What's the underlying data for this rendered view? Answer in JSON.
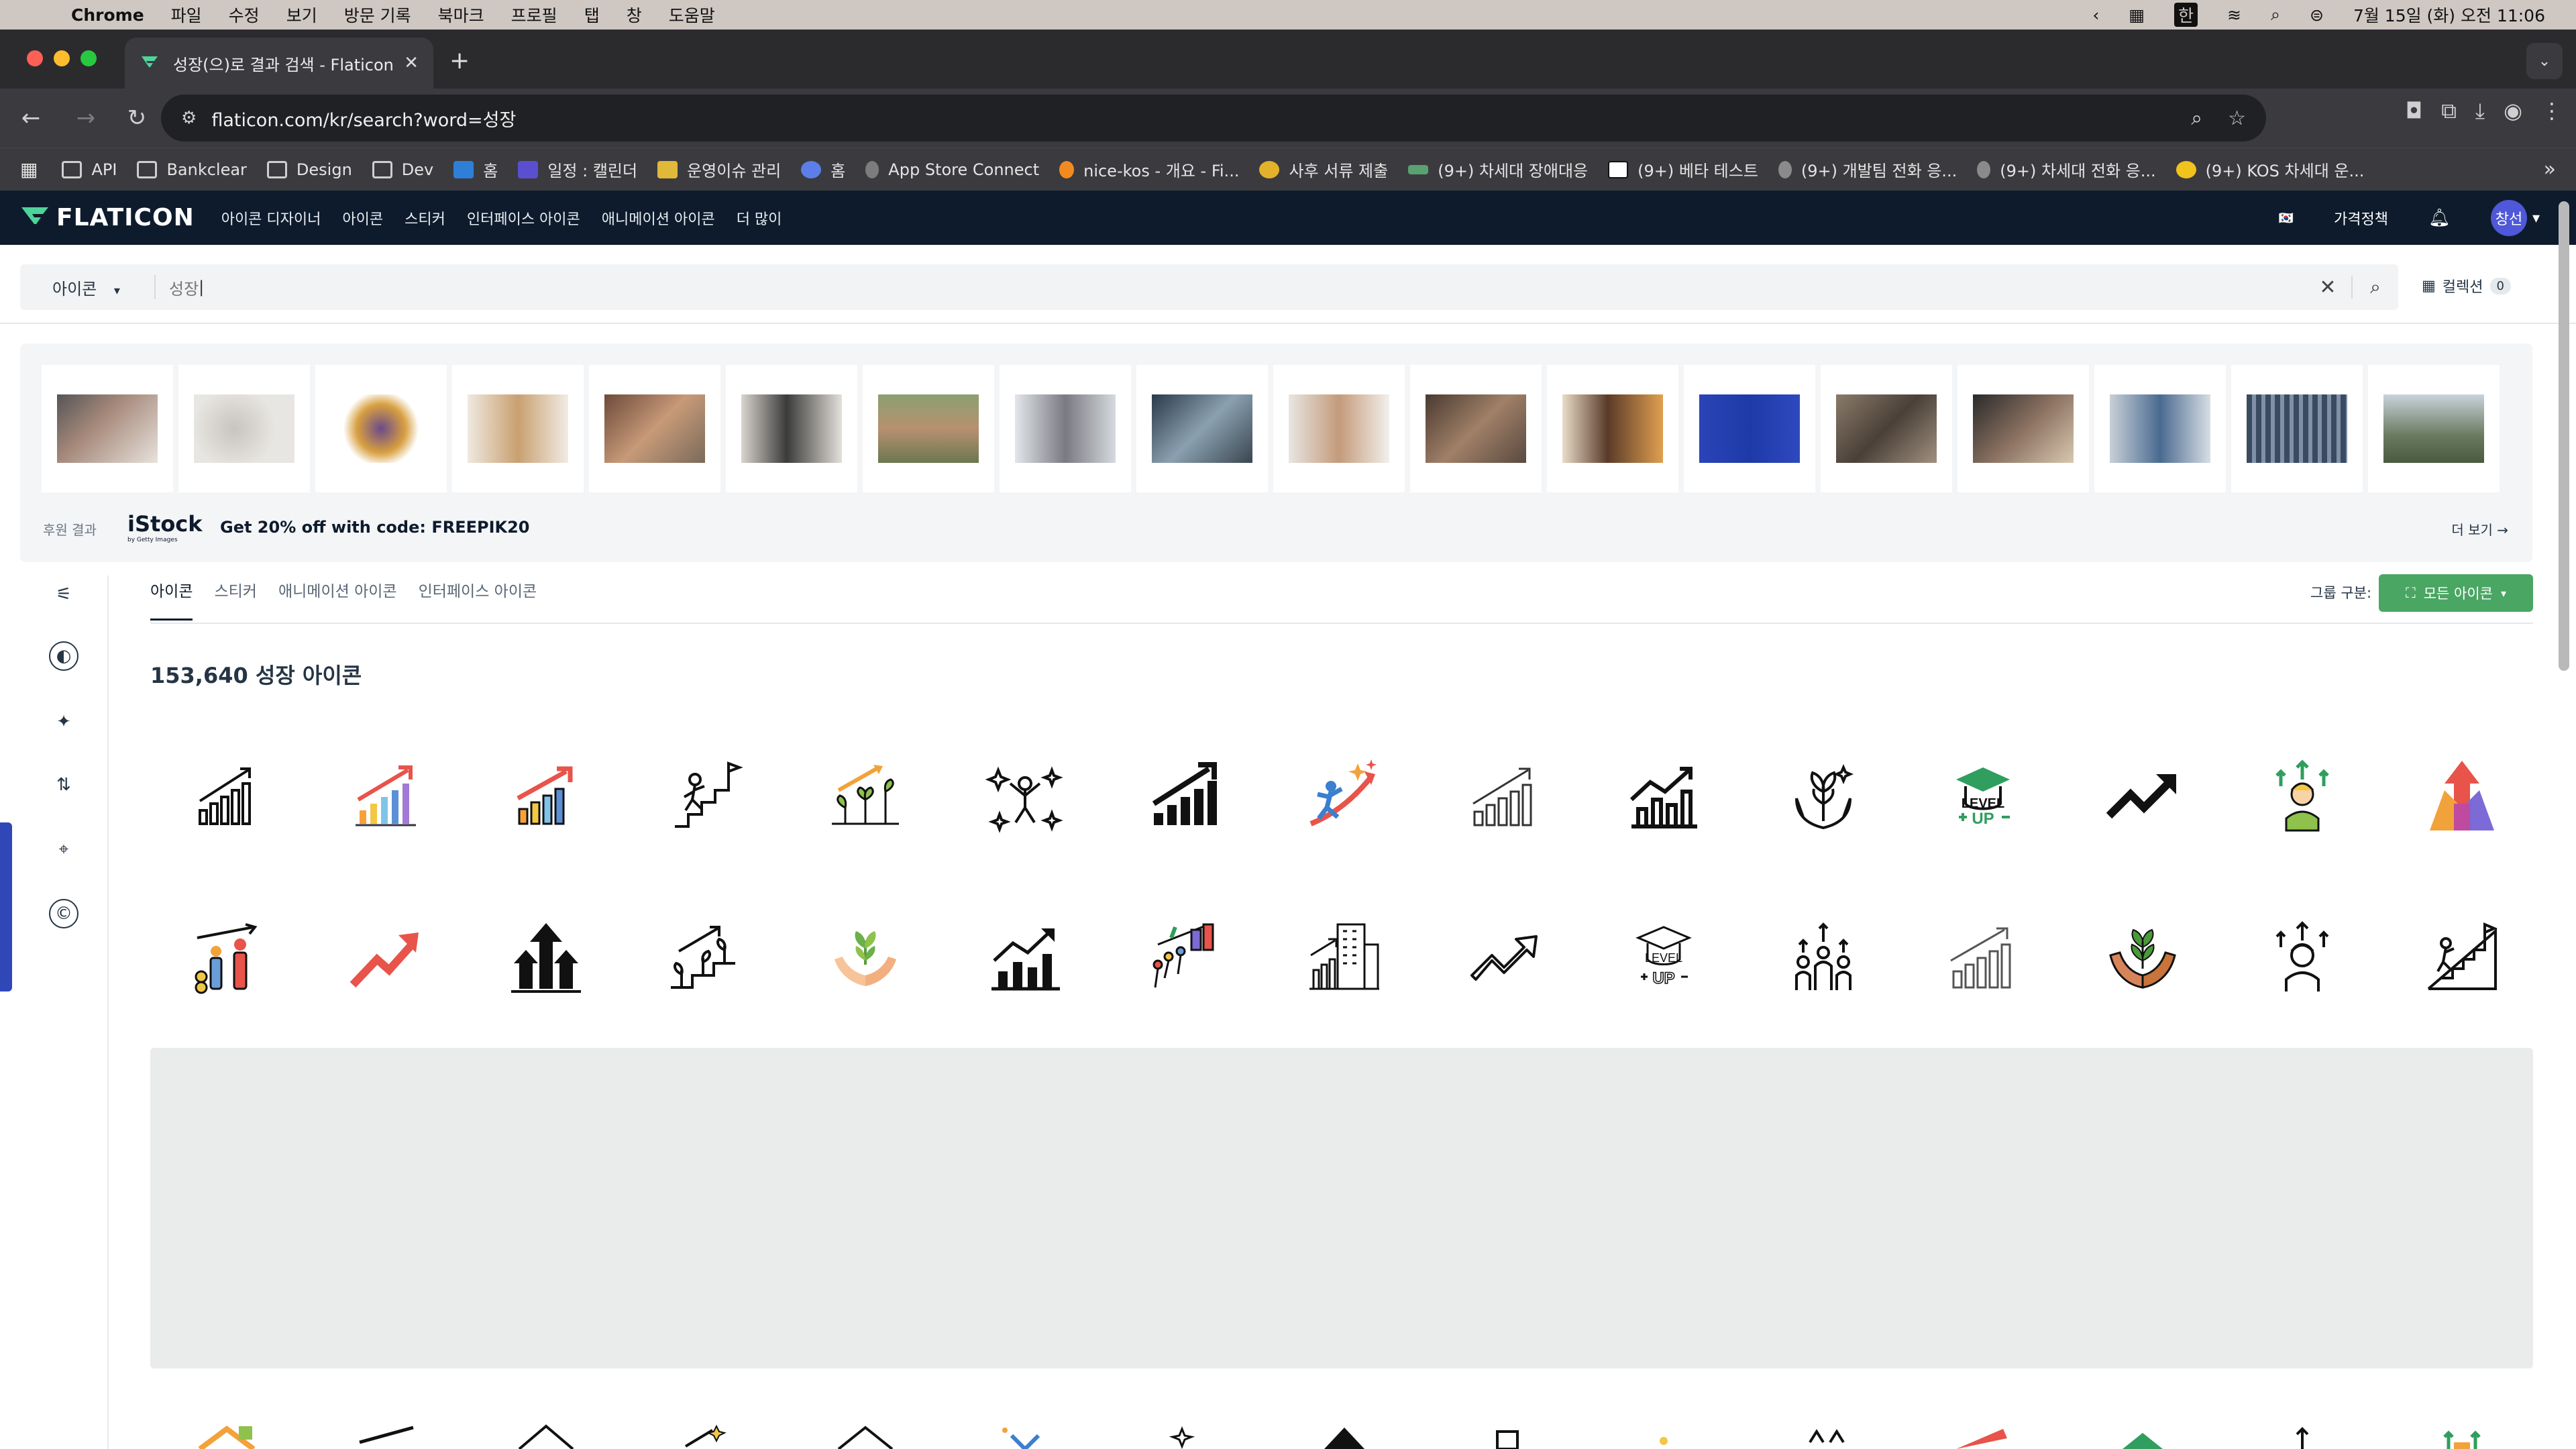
{
  "menubar": {
    "app": "Chrome",
    "items": [
      "파일",
      "수정",
      "보기",
      "방문 기록",
      "북마크",
      "프로필",
      "탭",
      "창",
      "도움말"
    ],
    "clock": "7월 15일 (화) 오전 11:06",
    "ime": "한"
  },
  "browser": {
    "tab_title": "성장(으)로 결과 검색 - Flaticon",
    "url": "flaticon.com/kr/search?word=성장",
    "bookmarks": [
      {
        "label": "API",
        "icon": "folder-icon"
      },
      {
        "label": "Bankclear",
        "icon": "folder-icon"
      },
      {
        "label": "Design",
        "icon": "folder-icon"
      },
      {
        "label": "Dev",
        "icon": "folder-icon"
      },
      {
        "label": "홈",
        "icon": "trello-icon"
      },
      {
        "label": "일정 : 캘린더",
        "icon": "calendar-icon"
      },
      {
        "label": "운영이슈 관리",
        "icon": "slides-icon"
      },
      {
        "label": "홈",
        "icon": "flow-icon"
      },
      {
        "label": "App Store Connect",
        "icon": "apple-icon"
      },
      {
        "label": "nice-kos - 개요 - Fi...",
        "icon": "firebase-icon"
      },
      {
        "label": "사후 서류 제출",
        "icon": "badge-icon"
      },
      {
        "label": "(9+) 차세대 장애대응",
        "icon": "bird-icon"
      },
      {
        "label": "(9+) 베타 테스트",
        "icon": "notion-icon"
      },
      {
        "label": "(9+) 개발팀 전화 응...",
        "icon": "phone-icon"
      },
      {
        "label": "(9+) 차세대 전화 응...",
        "icon": "phone-icon"
      },
      {
        "label": "(9+) KOS 차세대 운...",
        "icon": "sun-icon"
      }
    ]
  },
  "site": {
    "logo_text": "FLATICON",
    "nav": [
      "아이콘 디자이너",
      "아이콘",
      "스티커",
      "인터페이스 아이콘",
      "애니메이션 아이콘",
      "더 많이"
    ],
    "pricing": "가격정책",
    "avatar_text": "창선"
  },
  "search": {
    "type": "아이콘",
    "query": "성장",
    "collection_label": "컬렉션",
    "collection_count": "0"
  },
  "promo": {
    "label": "후원 결과",
    "brand": "iStock",
    "brand_sub": "by Getty Images",
    "code_text": "Get 20% off with code: FREEPIK20",
    "more": "더 보기"
  },
  "filters": {
    "tabs": [
      "아이콘",
      "스티커",
      "애니메이션 아이콘",
      "인터페이스 아이콘"
    ],
    "group_label": "그룹 구분:",
    "group_value": "모든 아이콘"
  },
  "results": {
    "count_text": "153,640 성장 아이콘",
    "row1": [
      "bar-chart-outline-icon",
      "bar-chart-color-icon",
      "bar-chart-arrow-color-icon",
      "climbing-steps-icon",
      "growing-plants-icon",
      "sparkle-person-icon",
      "bar-chart-solid-icon",
      "man-arrow-icon",
      "bar-chart-thin-icon",
      "bar-chart-bold-icon",
      "hands-leaves-icon",
      "level-up-green-icon",
      "trend-arrow-solid-icon",
      "person-arrows-color-icon",
      "arrow-up-gradient-icon"
    ],
    "row2": [
      "people-growth-icon",
      "trend-arrow-red-icon",
      "arrows-up-solid-icon",
      "plants-steps-icon",
      "hands-plant-color-icon",
      "bar-chart-trend-icon",
      "climbing-group-icon",
      "buildings-chart-icon",
      "trend-arrow-outline-icon",
      "level-up-outline-icon",
      "people-arrows-icon",
      "bar-chart-light-icon",
      "hands-plant-brown-icon",
      "person-arrows-outline-icon",
      "stairs-flag-icon"
    ]
  }
}
